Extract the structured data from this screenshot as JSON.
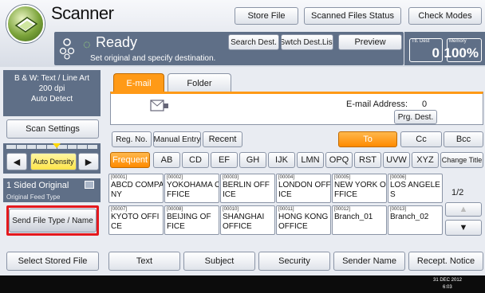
{
  "app": {
    "title": "Scanner"
  },
  "header": {
    "store_file": "Store File",
    "scanned_status": "Scanned Files Status",
    "check_modes": "Check Modes",
    "search_dest": "Search Dest.",
    "switch_dest": "Swtch Dest.List",
    "preview": "Preview"
  },
  "status": {
    "ready": "Ready",
    "message": "Set original and specify destination.",
    "ttl_dest_label": "Ttl. Dest",
    "ttl_dest_value": "0",
    "memory_label": "Memory",
    "memory_value": "100%"
  },
  "left": {
    "scan_mode": "B & W: Text / Line Art",
    "resolution": "200 dpi",
    "size": "Auto Detect",
    "scan_settings": "Scan Settings",
    "auto_density": "Auto Density",
    "sided": "1 Sided Original",
    "feed_type": "Original Feed Type",
    "send_file_type": "Send File Type / Name",
    "select_stored": "Select Stored File"
  },
  "tabs": {
    "email": "E-mail",
    "folder": "Folder"
  },
  "address": {
    "label": "E-mail Address:",
    "count": "0",
    "prg_dest": "Prg. Dest."
  },
  "row1": {
    "reg_no": "Reg. No.",
    "manual": "Manual Entry",
    "recent": "Recent",
    "to": "To",
    "cc": "Cc",
    "bcc": "Bcc"
  },
  "index_tabs": [
    "Frequent",
    "AB",
    "CD",
    "EF",
    "GH",
    "IJK",
    "LMN",
    "OPQ",
    "RST",
    "UVW",
    "XYZ",
    "Change Title"
  ],
  "destinations": [
    {
      "num": "[00001]",
      "name1": "ABCD COMPA",
      "name2": "NY"
    },
    {
      "num": "[00002]",
      "name1": "YOKOHAMA O",
      "name2": "FFICE"
    },
    {
      "num": "[00003]",
      "name1": "BERLIN OFF",
      "name2": "ICE"
    },
    {
      "num": "[00004]",
      "name1": "LONDON OFF",
      "name2": "ICE"
    },
    {
      "num": "[00005]",
      "name1": "NEW YORK O",
      "name2": "FFICE"
    },
    {
      "num": "[00006]",
      "name1": "LOS ANGELE",
      "name2": "S"
    },
    {
      "num": "[00007]",
      "name1": "KYOTO OFFI",
      "name2": "CE"
    },
    {
      "num": "[00008]",
      "name1": "BEIJING OF",
      "name2": "FICE"
    },
    {
      "num": "[00010]",
      "name1": "SHANGHAI",
      "name2": "OFFICE"
    },
    {
      "num": "[00011]",
      "name1": "HONG KONG",
      "name2": "OFFICE"
    },
    {
      "num": "[00012]",
      "name1": "Branch_01",
      "name2": ""
    },
    {
      "num": "[00013]",
      "name1": "Branch_02",
      "name2": ""
    }
  ],
  "paging": {
    "page": "1/2"
  },
  "bottom_tabs": [
    "Text",
    "Subject",
    "Security",
    "Sender Name",
    "Recept. Notice"
  ],
  "footer": {
    "date": "31 DEC  2012",
    "time": "6:03"
  },
  "colors": {
    "accent": "#ff9a17",
    "status_bar": "#5f6f87",
    "highlight": "#e4191e"
  }
}
